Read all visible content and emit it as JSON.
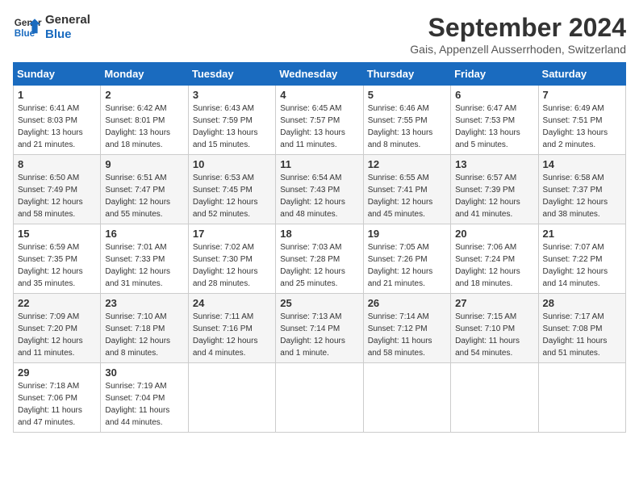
{
  "logo": {
    "line1": "General",
    "line2": "Blue"
  },
  "title": "September 2024",
  "subtitle": "Gais, Appenzell Ausserrhoden, Switzerland",
  "days_of_week": [
    "Sunday",
    "Monday",
    "Tuesday",
    "Wednesday",
    "Thursday",
    "Friday",
    "Saturday"
  ],
  "weeks": [
    [
      {
        "day": "1",
        "sunrise": "6:41 AM",
        "sunset": "8:03 PM",
        "daylight": "13 hours and 21 minutes."
      },
      {
        "day": "2",
        "sunrise": "6:42 AM",
        "sunset": "8:01 PM",
        "daylight": "13 hours and 18 minutes."
      },
      {
        "day": "3",
        "sunrise": "6:43 AM",
        "sunset": "7:59 PM",
        "daylight": "13 hours and 15 minutes."
      },
      {
        "day": "4",
        "sunrise": "6:45 AM",
        "sunset": "7:57 PM",
        "daylight": "13 hours and 11 minutes."
      },
      {
        "day": "5",
        "sunrise": "6:46 AM",
        "sunset": "7:55 PM",
        "daylight": "13 hours and 8 minutes."
      },
      {
        "day": "6",
        "sunrise": "6:47 AM",
        "sunset": "7:53 PM",
        "daylight": "13 hours and 5 minutes."
      },
      {
        "day": "7",
        "sunrise": "6:49 AM",
        "sunset": "7:51 PM",
        "daylight": "13 hours and 2 minutes."
      }
    ],
    [
      {
        "day": "8",
        "sunrise": "6:50 AM",
        "sunset": "7:49 PM",
        "daylight": "12 hours and 58 minutes."
      },
      {
        "day": "9",
        "sunrise": "6:51 AM",
        "sunset": "7:47 PM",
        "daylight": "12 hours and 55 minutes."
      },
      {
        "day": "10",
        "sunrise": "6:53 AM",
        "sunset": "7:45 PM",
        "daylight": "12 hours and 52 minutes."
      },
      {
        "day": "11",
        "sunrise": "6:54 AM",
        "sunset": "7:43 PM",
        "daylight": "12 hours and 48 minutes."
      },
      {
        "day": "12",
        "sunrise": "6:55 AM",
        "sunset": "7:41 PM",
        "daylight": "12 hours and 45 minutes."
      },
      {
        "day": "13",
        "sunrise": "6:57 AM",
        "sunset": "7:39 PM",
        "daylight": "12 hours and 41 minutes."
      },
      {
        "day": "14",
        "sunrise": "6:58 AM",
        "sunset": "7:37 PM",
        "daylight": "12 hours and 38 minutes."
      }
    ],
    [
      {
        "day": "15",
        "sunrise": "6:59 AM",
        "sunset": "7:35 PM",
        "daylight": "12 hours and 35 minutes."
      },
      {
        "day": "16",
        "sunrise": "7:01 AM",
        "sunset": "7:33 PM",
        "daylight": "12 hours and 31 minutes."
      },
      {
        "day": "17",
        "sunrise": "7:02 AM",
        "sunset": "7:30 PM",
        "daylight": "12 hours and 28 minutes."
      },
      {
        "day": "18",
        "sunrise": "7:03 AM",
        "sunset": "7:28 PM",
        "daylight": "12 hours and 25 minutes."
      },
      {
        "day": "19",
        "sunrise": "7:05 AM",
        "sunset": "7:26 PM",
        "daylight": "12 hours and 21 minutes."
      },
      {
        "day": "20",
        "sunrise": "7:06 AM",
        "sunset": "7:24 PM",
        "daylight": "12 hours and 18 minutes."
      },
      {
        "day": "21",
        "sunrise": "7:07 AM",
        "sunset": "7:22 PM",
        "daylight": "12 hours and 14 minutes."
      }
    ],
    [
      {
        "day": "22",
        "sunrise": "7:09 AM",
        "sunset": "7:20 PM",
        "daylight": "12 hours and 11 minutes."
      },
      {
        "day": "23",
        "sunrise": "7:10 AM",
        "sunset": "7:18 PM",
        "daylight": "12 hours and 8 minutes."
      },
      {
        "day": "24",
        "sunrise": "7:11 AM",
        "sunset": "7:16 PM",
        "daylight": "12 hours and 4 minutes."
      },
      {
        "day": "25",
        "sunrise": "7:13 AM",
        "sunset": "7:14 PM",
        "daylight": "12 hours and 1 minute."
      },
      {
        "day": "26",
        "sunrise": "7:14 AM",
        "sunset": "7:12 PM",
        "daylight": "11 hours and 58 minutes."
      },
      {
        "day": "27",
        "sunrise": "7:15 AM",
        "sunset": "7:10 PM",
        "daylight": "11 hours and 54 minutes."
      },
      {
        "day": "28",
        "sunrise": "7:17 AM",
        "sunset": "7:08 PM",
        "daylight": "11 hours and 51 minutes."
      }
    ],
    [
      {
        "day": "29",
        "sunrise": "7:18 AM",
        "sunset": "7:06 PM",
        "daylight": "11 hours and 47 minutes."
      },
      {
        "day": "30",
        "sunrise": "7:19 AM",
        "sunset": "7:04 PM",
        "daylight": "11 hours and 44 minutes."
      },
      null,
      null,
      null,
      null,
      null
    ]
  ]
}
